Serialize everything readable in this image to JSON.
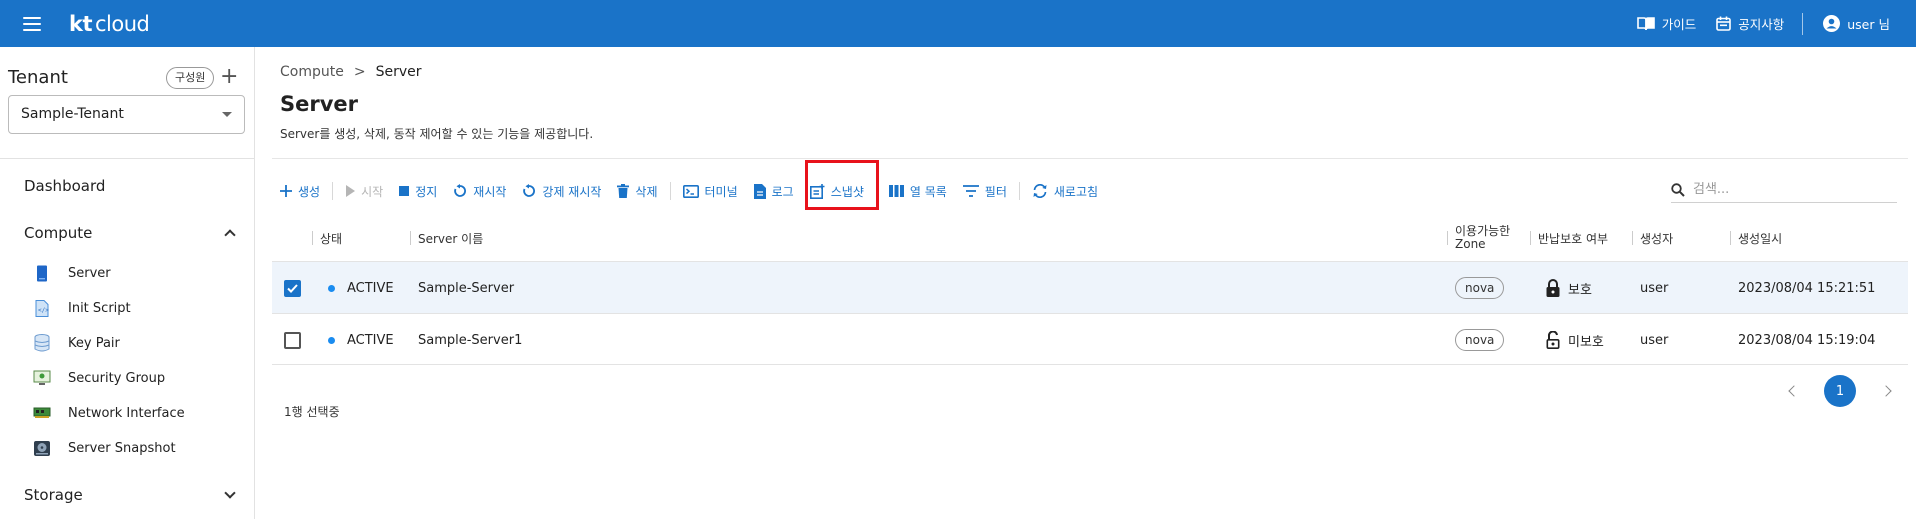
{
  "header": {
    "logo_kt": "kt",
    "logo_cloud": "cloud",
    "guide": "가이드",
    "notice": "공지사항",
    "user": "user 님"
  },
  "sidebar": {
    "tenant_label": "Tenant",
    "member_button": "구성원",
    "add_symbol": "+",
    "tenant_selected": "Sample-Tenant",
    "dashboard": "Dashboard",
    "compute": "Compute",
    "compute_items": [
      {
        "label": "Server",
        "icon": "server-icon"
      },
      {
        "label": "Init Script",
        "icon": "script-icon"
      },
      {
        "label": "Key Pair",
        "icon": "database-icon"
      },
      {
        "label": "Security Group",
        "icon": "monitor-icon"
      },
      {
        "label": "Network Interface",
        "icon": "nic-icon"
      },
      {
        "label": "Server Snapshot",
        "icon": "disk-icon"
      }
    ],
    "storage": "Storage"
  },
  "main": {
    "breadcrumb_parent": "Compute",
    "breadcrumb_sep": ">",
    "breadcrumb_current": "Server",
    "title": "Server",
    "description": "Server를 생성, 삭제, 동작 제어할 수 있는 기능을 제공합니다."
  },
  "toolbar": {
    "create": "생성",
    "start": "시작",
    "stop": "정지",
    "restart": "재시작",
    "force_restart": "강제 재시작",
    "delete": "삭제",
    "terminal": "터미널",
    "log": "로그",
    "snapshot": "스냅샷",
    "columns": "열 목록",
    "filter": "필터",
    "refresh": "새로고침",
    "search_placeholder": "검색..."
  },
  "table": {
    "headers": {
      "status": "상태",
      "name": "Server 이름",
      "zone_line1": "이용가능한",
      "zone_line2": "Zone",
      "protect": "반납보호 여부",
      "creator": "생성자",
      "created": "생성일시"
    },
    "rows": [
      {
        "checked": true,
        "status": "ACTIVE",
        "name": "Sample-Server",
        "zone": "nova",
        "protect": "보호",
        "creator": "user",
        "created": "2023/08/04 15:21:51"
      },
      {
        "checked": false,
        "status": "ACTIVE",
        "name": "Sample-Server1",
        "zone": "nova",
        "protect": "미보호",
        "creator": "user",
        "created": "2023/08/04 15:19:04"
      }
    ],
    "selected_count": "1행 선택중"
  },
  "pagination": {
    "current": "1"
  },
  "colors": {
    "primary": "#1a73c8",
    "highlight": "#e8121b",
    "status_active": "#1a8cf0"
  }
}
